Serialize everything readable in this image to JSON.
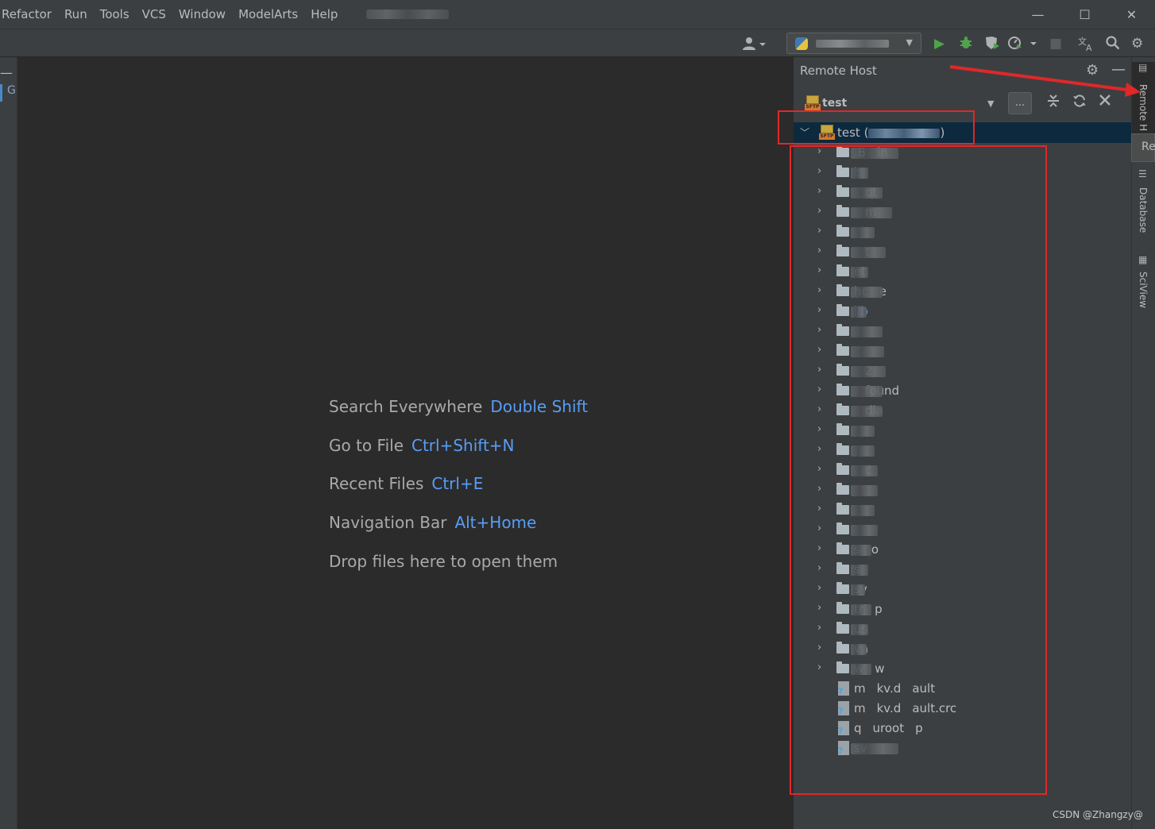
{
  "menu": {
    "items": [
      "Refactor",
      "Run",
      "Tools",
      "VCS",
      "Window",
      "ModelArts",
      "Help"
    ]
  },
  "window_controls": {
    "minimize": "—",
    "maximize": "☐",
    "close": "✕"
  },
  "toolbar": {
    "user_icon": "user-icon",
    "run_config_icon": "python-icon",
    "run_icon": "▶",
    "debug_icon": "bug-icon",
    "coverage_icon": "coverage-icon",
    "profile_icon": "profile-icon",
    "stop_icon": "■",
    "translate_icon": "translate-icon",
    "search_icon": "⌕",
    "settings_icon": "⚙",
    "colors": {
      "run": "#4fa34a",
      "debug": "#4fa34a"
    }
  },
  "left_strip": {
    "tab_letter": "G"
  },
  "editor": {
    "hints": [
      {
        "label": "Search Everywhere",
        "key": "Double Shift"
      },
      {
        "label": "Go to File",
        "key": "Ctrl+Shift+N"
      },
      {
        "label": "Recent Files",
        "key": "Ctrl+E"
      },
      {
        "label": "Navigation Bar",
        "key": "Alt+Home"
      },
      {
        "label": "Drop files here to open them",
        "key": ""
      }
    ]
  },
  "remote_host": {
    "title": "Remote Host",
    "connection": {
      "name": "test",
      "badge": "SFTP",
      "more_label": "..."
    },
    "root": {
      "label_prefix": "test (",
      "label_suffix": ")"
    },
    "tree": [
      {
        "type": "folder",
        "text": ".B",
        "text2": "in",
        "blur": 60
      },
      {
        "type": "folder",
        "text": "b",
        "blue": true,
        "blur": 22
      },
      {
        "type": "folder",
        "text": "",
        "text2": "ot",
        "blur": 40
      },
      {
        "type": "folder",
        "text": "",
        "text2": "m",
        "blur": 52
      },
      {
        "type": "folder",
        "text": "",
        "blur": 30
      },
      {
        "type": "folder",
        "text": "",
        "text2": "t",
        "blur": 44
      },
      {
        "type": "folder",
        "text": "et",
        "blur": 22
      },
      {
        "type": "folder",
        "text": "hc",
        "text2": "e",
        "blur": 40
      },
      {
        "type": "folder",
        "text": "lib",
        "blue": true,
        "blur": 20
      },
      {
        "type": "folder",
        "text": "",
        "blur": 40
      },
      {
        "type": "folder",
        "text": "",
        "blue": true,
        "blur": 42
      },
      {
        "type": "folder",
        "text": "",
        "text2": "2",
        "blur": 44
      },
      {
        "type": "folder",
        "text": "",
        "text2": "found",
        "blur": 40
      },
      {
        "type": "folder",
        "text": "",
        "text2": "dia",
        "blur": 40
      },
      {
        "type": "folder",
        "text": "",
        "blur": 30
      },
      {
        "type": "folder",
        "text": "",
        "blur": 30
      },
      {
        "type": "folder",
        "text": "",
        "text2": "c",
        "blur": 34
      },
      {
        "type": "folder",
        "text": "",
        "blur": 34
      },
      {
        "type": "folder",
        "text": "",
        "blur": 30
      },
      {
        "type": "folder",
        "text": "",
        "blue": true,
        "blur": 34
      },
      {
        "type": "folder",
        "text": "s",
        "text2": "o",
        "blur": 26
      },
      {
        "type": "folder",
        "text": "s",
        "blur": 22
      },
      {
        "type": "folder",
        "text": "sy",
        "blur": 18
      },
      {
        "type": "folder",
        "text": "tr",
        "text2": "p",
        "blur": 26
      },
      {
        "type": "folder",
        "text": "us",
        "blur": 22
      },
      {
        "type": "folder",
        "text": "va",
        "blur": 20
      },
      {
        "type": "folder",
        "text": "w",
        "text2": "w",
        "blur": 26
      },
      {
        "type": "file",
        "text": "m",
        "text2": "kv.d",
        "text3": "ault",
        "blur": 0
      },
      {
        "type": "file",
        "text": "m",
        "text2": "kv.d",
        "text3": "ault.crc",
        "blur": 0
      },
      {
        "type": "file",
        "text": "q",
        "text2": "uroot",
        "text3": "p",
        "blur": 0
      },
      {
        "type": "file",
        "text": "sv",
        "blur": 60
      }
    ]
  },
  "right_strip": {
    "tabs": [
      {
        "label": "Remote H",
        "icon": "remote-host-icon"
      },
      {
        "label": "Database",
        "icon": "database-icon"
      },
      {
        "label": "SciView",
        "icon": "sciview-icon"
      }
    ],
    "tooltip": "Re"
  },
  "watermark": "CSDN @Zhangzy@",
  "annotation_color": "#e02828"
}
